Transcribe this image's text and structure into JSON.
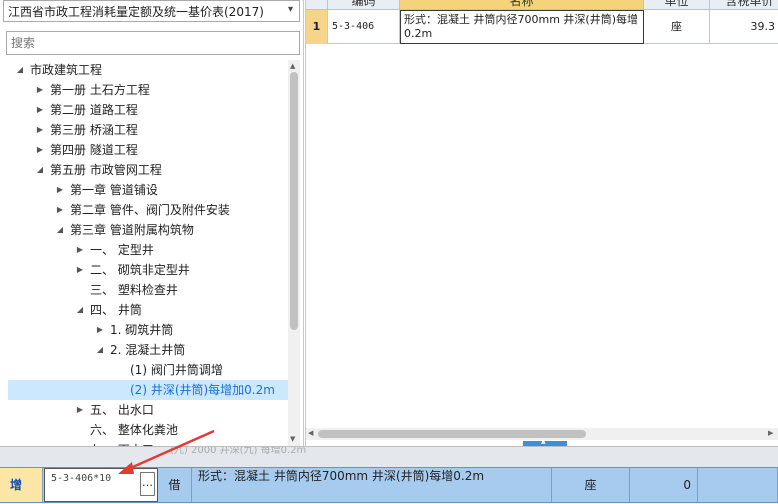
{
  "library": {
    "selected": "江西省市政工程消耗量定额及统一基价表(2017)"
  },
  "search": {
    "placeholder": "搜索"
  },
  "tree": [
    {
      "label": "市政建筑工程",
      "state": "expanded"
    },
    {
      "label": "第一册  土石方工程",
      "state": "collapsed"
    },
    {
      "label": "第二册  道路工程",
      "state": "collapsed"
    },
    {
      "label": "第三册  桥涵工程",
      "state": "collapsed"
    },
    {
      "label": "第四册  隧道工程",
      "state": "collapsed"
    },
    {
      "label": "第五册  市政管网工程",
      "state": "expanded"
    },
    {
      "label": "第一章  管道铺设",
      "state": "collapsed"
    },
    {
      "label": "第二章  管件、阀门及附件安装",
      "state": "collapsed"
    },
    {
      "label": "第三章  管道附属构筑物",
      "state": "expanded"
    },
    {
      "label": "一、   定型井",
      "state": "collapsed"
    },
    {
      "label": "二、   砌筑非定型井",
      "state": "collapsed"
    },
    {
      "label": "三、   塑料检查井",
      "state": "leaf"
    },
    {
      "label": "四、   井筒",
      "state": "expanded"
    },
    {
      "label": "1. 砌筑井筒",
      "state": "collapsed"
    },
    {
      "label": "2. 混凝土井筒",
      "state": "expanded"
    },
    {
      "label": "(1) 阀门井筒调增",
      "state": "leaf"
    },
    {
      "label": "(2) 井深(井筒)每增加0.2m",
      "state": "leaf",
      "selected": true
    },
    {
      "label": "五、   出水口",
      "state": "collapsed"
    },
    {
      "label": "六、   整体化粪池",
      "state": "leaf"
    },
    {
      "label": "七、   雨水口",
      "state": "collapsed"
    }
  ],
  "grid": {
    "headers": [
      "编码",
      "名称",
      "单位",
      "含税单价"
    ],
    "rows": [
      {
        "num": "1",
        "code": "5-3-406",
        "name": "形式：混凝土  井筒内径700mm  井深(井筒)每增0.2m",
        "unit": "座",
        "price": "39.3"
      }
    ]
  },
  "bottom": {
    "faint_text": "(九) 2000 井深(九) 每增0.2m",
    "row": {
      "type": "增",
      "code_input": "5-3-406*10",
      "ellipsis": "…",
      "sub": "借",
      "name": "形式：混凝土  井筒内径700mm 井深(井筒)每增0.2m",
      "unit": "座",
      "value": "0"
    }
  },
  "colors": {
    "selection_bg": "#cce8ff",
    "selection_text": "#1a6fd6",
    "row_highlight": "#a7cbee",
    "annotation_arrow": "#e53935"
  },
  "icons": {
    "expanded": "triangle-down",
    "collapsed": "triangle-right",
    "dropdown": "chevron-down",
    "ellipsis": "ellipsis"
  }
}
